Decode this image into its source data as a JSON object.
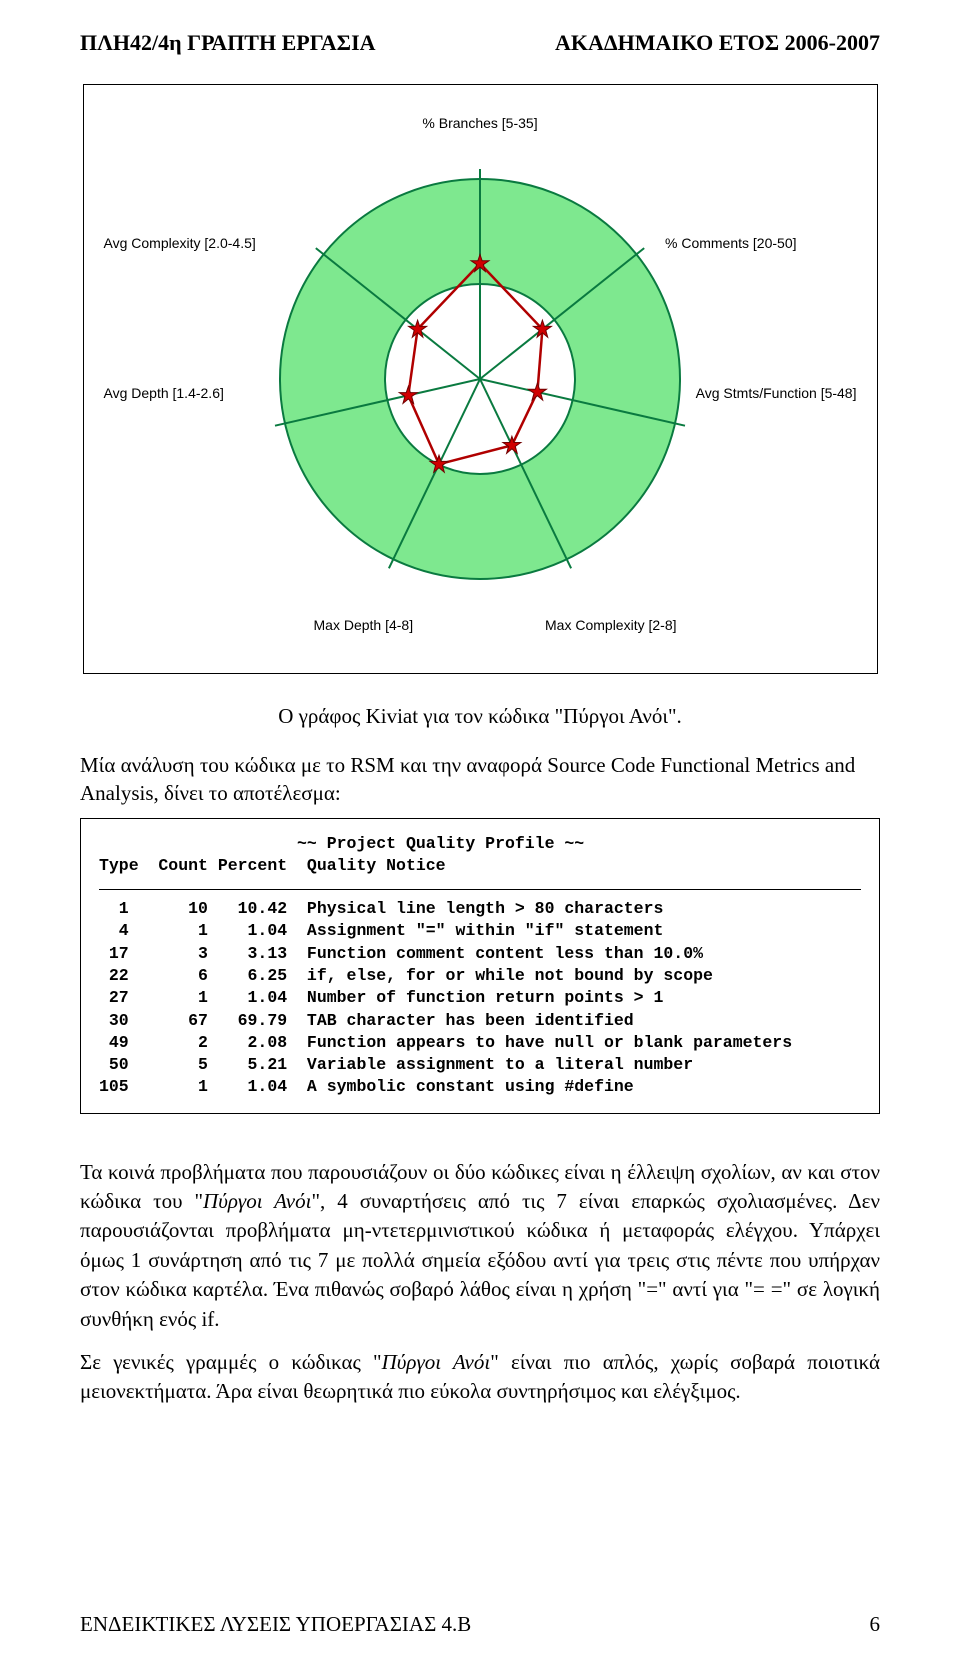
{
  "header": {
    "left": "ΠΛΗ42/4η ΓΡΑΠΤΗ ΕΡΓΑΣΙΑ",
    "right": "ΑΚΑΔΗΜΑΙΚΟ ΕΤΟΣ 2006-2007"
  },
  "chart": {
    "labels": {
      "top": "% Branches [5-35]",
      "tr": "% Comments [20-50]",
      "mr": "Avg Stmts/Function [5-48]",
      "br": "Max Complexity [2-8]",
      "bl": "Max Depth [4-8]",
      "ml": "Avg Depth [1.4-2.6]",
      "tl": "Avg Complexity [2.0-4.5]"
    }
  },
  "chart_data": {
    "type": "radar",
    "title": "Kiviat diagram — Πύργοι Ανόι code quality",
    "axes": [
      {
        "name": "% Branches",
        "range": [
          5,
          35
        ]
      },
      {
        "name": "% Comments",
        "range": [
          20,
          50
        ]
      },
      {
        "name": "Avg Stmts/Function",
        "range": [
          5,
          48
        ]
      },
      {
        "name": "Max Complexity",
        "range": [
          2,
          8
        ]
      },
      {
        "name": "Max Depth",
        "range": [
          4,
          8
        ]
      },
      {
        "name": "Avg Depth",
        "range": [
          1.4,
          2.6
        ]
      },
      {
        "name": "Avg Complexity",
        "range": [
          2.0,
          4.5
        ]
      }
    ],
    "series": [
      {
        "name": "Πύργοι Ανόι",
        "values_normalized": [
          0.55,
          0.38,
          0.28,
          0.35,
          0.45,
          0.35,
          0.38
        ],
        "note": "values_normalized are 0..1 radii; shaded green band = accepted range (≈0.33–1.0)"
      }
    ]
  },
  "caption": "Ο γράφος Kiviat για τον κώδικα \"Πύργοι Ανόι\".",
  "lead": "Μία ανάλυση του κώδικα με το RSM και την αναφορά Source Code Functional Metrics and Analysis, δίνει το αποτέλεσμα:",
  "code": {
    "title": "                    ~~ Project Quality Profile ~~",
    "header": "Type  Count Percent  Quality Notice",
    "rows": [
      "  1      10   10.42  Physical line length > 80 characters",
      "  4       1    1.04  Assignment \"=\" within \"if\" statement",
      " 17       3    3.13  Function comment content less than 10.0%",
      " 22       6    6.25  if, else, for or while not bound by scope",
      " 27       1    1.04  Number of function return points > 1",
      " 30      67   69.79  TAB character has been identified",
      " 49       2    2.08  Function appears to have null or blank parameters",
      " 50       5    5.21  Variable assignment to a literal number",
      "105       1    1.04  A symbolic constant using #define"
    ]
  },
  "para1_a": "Τα κοινά προβλήματα που παρουσιάζουν οι δύο κώδικες είναι η έλλειψη σχολίων, αν και στον κώδικα του \"",
  "para1_i": "Πύργοι Ανόι",
  "para1_b": "\", 4 συναρτήσεις από τις 7 είναι επαρκώς σχολιασμένες. Δεν παρουσιάζονται προβλήματα μη-ντετερμινιστικού κώδικα ή μεταφοράς ελέγχου. Υπάρχει όμως 1 συνάρτηση από τις 7 με πολλά σημεία εξόδου αντί για τρεις στις πέντε που υπήρχαν στον κώδικα καρτέλα. Ένα πιθανώς σοβαρό λάθος είναι η χρήση \"=\" αντί για \"= =\" σε λογική συνθήκη ενός if.",
  "para2_a": "Σε γενικές γραμμές ο κώδικας \"",
  "para2_i": "Πύργοι Ανόι",
  "para2_b": "\" είναι πιο απλός, χωρίς σοβαρά ποιοτικά μειονεκτήματα. Άρα είναι θεωρητικά πιο εύκολα συντηρήσιμος και ελέγξιμος.",
  "footer": {
    "left": "ΕΝΔΕΙΚΤΙΚΕΣ ΛΥΣΕΙΣ ΥΠΟΕΡΓΑΣΙΑΣ 4.Β",
    "right": "6"
  }
}
